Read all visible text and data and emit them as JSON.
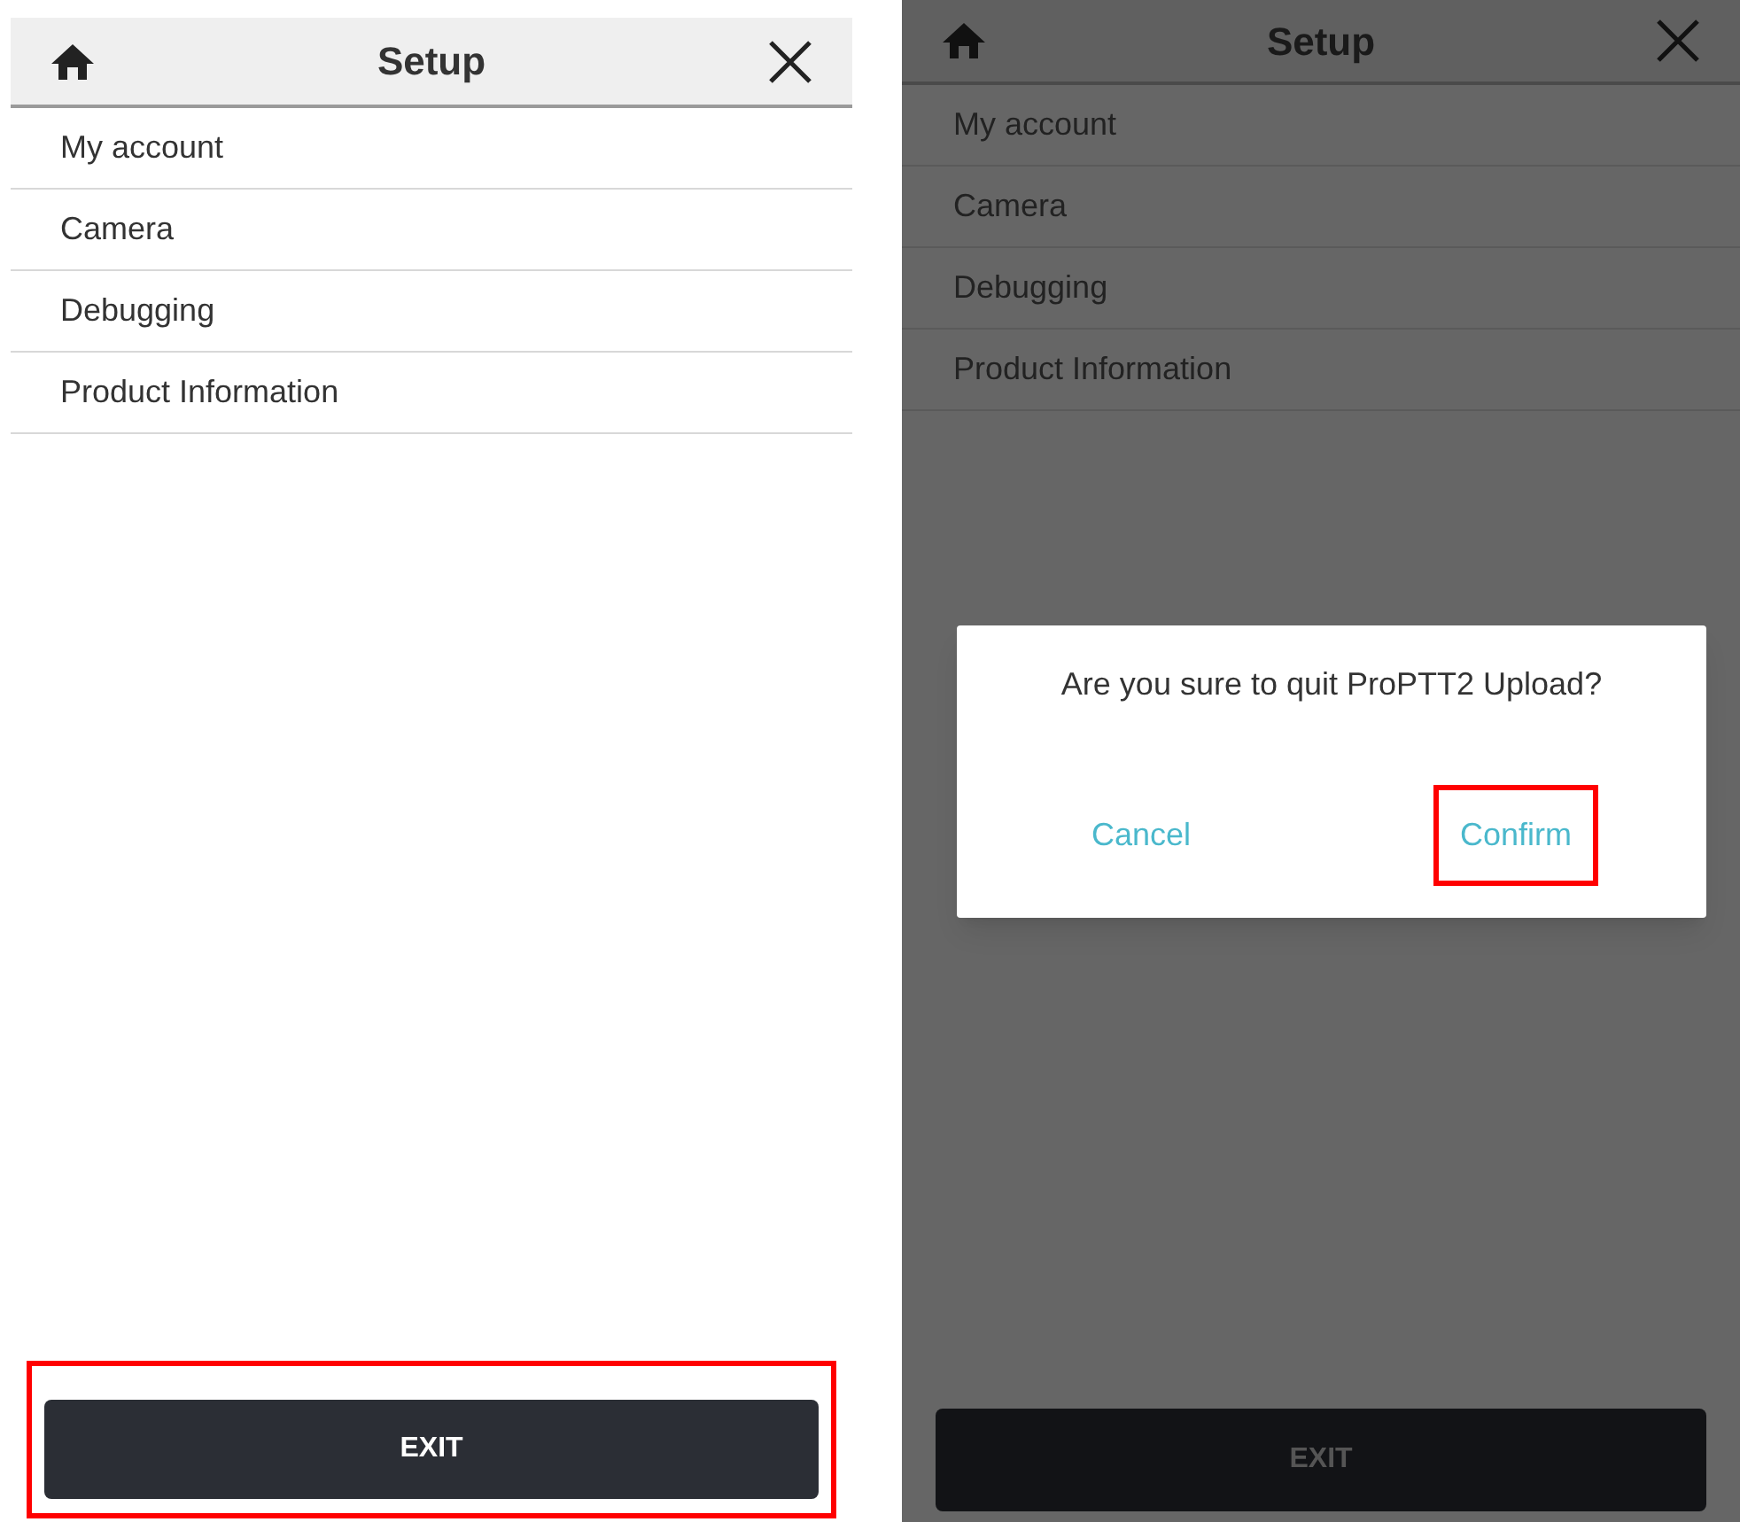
{
  "screens": [
    {
      "title": "Setup",
      "dimmed": false,
      "menu_items": [
        "My account",
        "Camera",
        "Debugging",
        "Product Information"
      ],
      "exit_button": {
        "label": "EXIT",
        "highlighted": true
      }
    },
    {
      "title": "Setup",
      "dimmed": true,
      "menu_items": [
        "My account",
        "Camera",
        "Debugging",
        "Product Information"
      ],
      "exit_button": {
        "label": "EXIT",
        "highlighted": false
      },
      "dialog": {
        "message": "Are you sure to quit ProPTT2 Upload?",
        "buttons": [
          {
            "label": "Cancel",
            "highlighted": false
          },
          {
            "label": "Confirm",
            "highlighted": true
          }
        ]
      }
    }
  ]
}
